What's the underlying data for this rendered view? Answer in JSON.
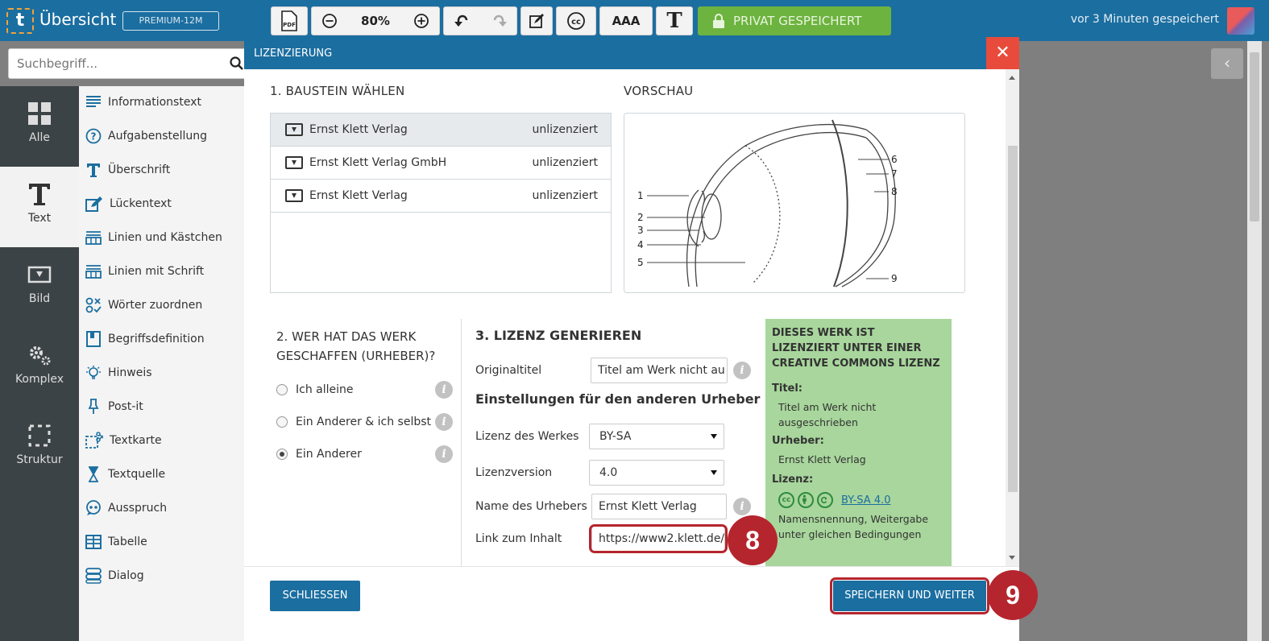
{
  "topbar": {
    "logo_letter": "t",
    "title": "Übersicht",
    "plan_badge": "PREMIUM-12M",
    "pdf_label": "PDF",
    "zoom": "80%",
    "font_size_label": "AAA",
    "text_button_label": "T",
    "cc_label": "cc",
    "private_label": "PRIVAT GESPEICHERT",
    "saved_status": "vor 3 Minuten gespeichert"
  },
  "search": {
    "placeholder": "Suchbegriff..."
  },
  "categories": [
    {
      "label": "Alle",
      "icon": "grid-icon"
    },
    {
      "label": "Text",
      "icon": "text-icon"
    },
    {
      "label": "Bild",
      "icon": "image-icon"
    },
    {
      "label": "Komplex",
      "icon": "gears-icon"
    },
    {
      "label": "Struktur",
      "icon": "dashed-square-icon"
    }
  ],
  "items": [
    {
      "label": "Informationstext",
      "icon": "lines-icon"
    },
    {
      "label": "Aufgabenstellung",
      "icon": "question-icon"
    },
    {
      "label": "Überschrift",
      "icon": "heading-icon"
    },
    {
      "label": "Lückentext",
      "icon": "edit-icon"
    },
    {
      "label": "Linien und Kästchen",
      "icon": "lines-boxes-icon"
    },
    {
      "label": "Linien mit Schrift",
      "icon": "lines-text-icon"
    },
    {
      "label": "Wörter zuordnen",
      "icon": "match-icon"
    },
    {
      "label": "Begriffsdefinition",
      "icon": "book-icon"
    },
    {
      "label": "Hinweis",
      "icon": "bulb-icon"
    },
    {
      "label": "Post-it",
      "icon": "pin-icon"
    },
    {
      "label": "Textkarte",
      "icon": "scissors-icon"
    },
    {
      "label": "Textquelle",
      "icon": "hourglass-icon"
    },
    {
      "label": "Ausspruch",
      "icon": "speech-icon"
    },
    {
      "label": "Tabelle",
      "icon": "table-icon"
    },
    {
      "label": "Dialog",
      "icon": "dialog-icon"
    }
  ],
  "modal": {
    "title": "LIZENZIERUNG",
    "close_symbol": "✕",
    "section1": "1. BAUSTEIN WÄHLEN",
    "preview_heading": "VORSCHAU",
    "blocks": [
      {
        "name": "Ernst Klett Verlag",
        "status": "unlizenziert"
      },
      {
        "name": "Ernst Klett Verlag GmbH",
        "status": "unlizenziert"
      },
      {
        "name": "Ernst Klett Verlag",
        "status": "unlizenziert"
      }
    ],
    "diagram_numbers": [
      "1",
      "2",
      "3",
      "4",
      "5",
      "6",
      "7",
      "8",
      "9"
    ],
    "section2": "2. WER HAT DAS WERK GESCHAFFEN (URHEBER)?",
    "authors": [
      {
        "label": "Ich alleine",
        "checked": false
      },
      {
        "label": "Ein Anderer & ich selbst",
        "checked": false
      },
      {
        "label": "Ein Anderer",
        "checked": true
      }
    ],
    "section3": "3. LIZENZ GENERIEREN",
    "original_title_label": "Originaltitel",
    "original_title_value": "Titel am Werk nicht au",
    "settings_heading": "Einstellungen für den anderen Urheber",
    "license_label": "Lizenz des Werkes",
    "license_value": "BY-SA",
    "version_label": "Lizenzversion",
    "version_value": "4.0",
    "author_name_label": "Name des Urhebers",
    "author_name_value": "Ernst Klett Verlag",
    "link_label": "Link zum Inhalt",
    "link_value": "https://www2.klett.de/",
    "info_symbol": "i",
    "license_box": {
      "heading": "DIESES WERK IST LIZENZIERT UNTER EINER CREATIVE COMMONS LIZENZ",
      "title_label": "Titel:",
      "title_value": "Titel am Werk nicht ausgeschrieben",
      "author_label": "Urheber:",
      "author_value": "Ernst Klett Verlag",
      "license_label": "Lizenz:",
      "cc_icons": [
        "cc",
        "by",
        "sa"
      ],
      "license_link": "BY-SA 4.0",
      "license_desc": "Namensnennung, Weitergabe unter gleichen Bedingungen"
    },
    "close_button": "SCHLIESSEN",
    "save_button": "SPEICHERN UND WEITER"
  },
  "markers": {
    "step8": "8",
    "step9": "9"
  },
  "colors": {
    "primary": "#1b6ea0",
    "private": "#6db33f",
    "close": "#e84b3c",
    "license_box": "#a8d69c",
    "marker": "#b5252d",
    "sidebar": "#3c4347"
  },
  "right_panel": {
    "collapse_symbol": "‹"
  }
}
